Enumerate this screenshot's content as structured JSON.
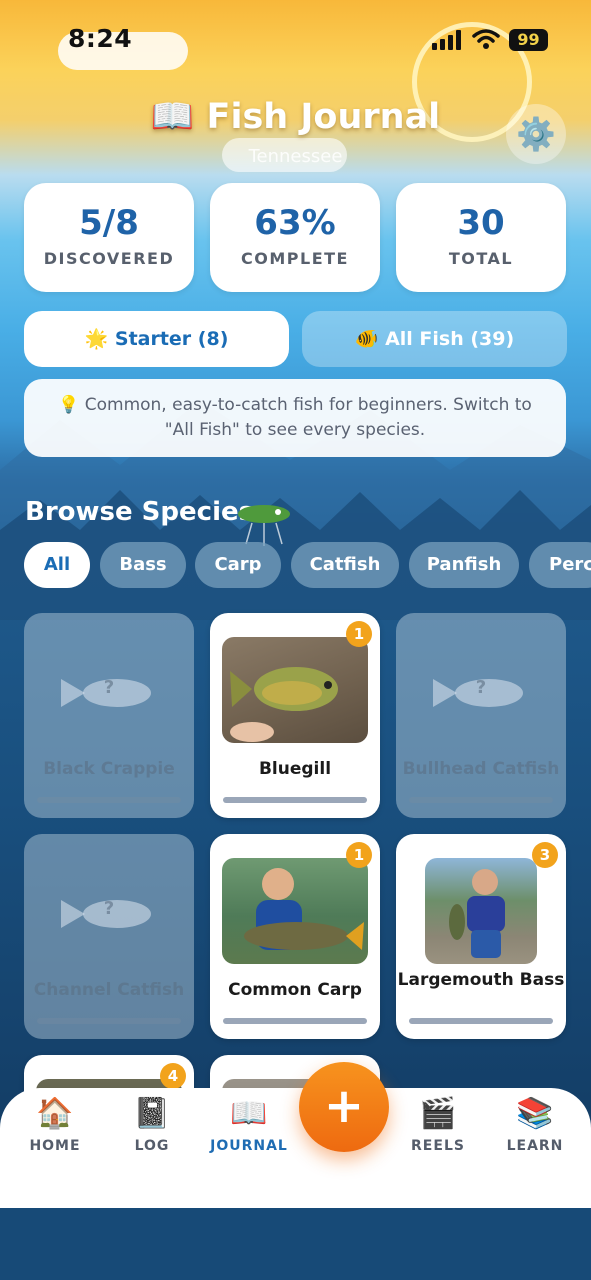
{
  "status_bar": {
    "time": "8:24",
    "battery": "99"
  },
  "header": {
    "title": "📖 Fish Journal",
    "subtitle": "Tennessee",
    "settings_icon": "⚙️"
  },
  "stats": [
    {
      "value": "5/8",
      "label": "DISCOVERED"
    },
    {
      "value": "63%",
      "label": "COMPLETE"
    },
    {
      "value": "30",
      "label": "TOTAL"
    }
  ],
  "mode_toggle": {
    "starter": "🌟 Starter (8)",
    "all_fish": "🐠 All Fish (39)",
    "selected": "starter"
  },
  "tip": {
    "icon": "💡",
    "text": "Common, easy-to-catch fish for beginners. Switch to \"All Fish\" to see every species."
  },
  "browse": {
    "title": "Browse Species",
    "filters": [
      "All",
      "Bass",
      "Carp",
      "Catfish",
      "Panfish",
      "Perc"
    ],
    "selected_filter": "All"
  },
  "species": [
    {
      "name": "Black Crappie",
      "discovered": false
    },
    {
      "name": "Bluegill",
      "discovered": true,
      "count": "1"
    },
    {
      "name": "Bullhead Catfish",
      "discovered": false
    },
    {
      "name": "Channel Catfish",
      "discovered": false
    },
    {
      "name": "Common Carp",
      "discovered": true,
      "count": "1"
    },
    {
      "name": "Largemouth Bass",
      "discovered": true,
      "count": "3"
    },
    {
      "name": "",
      "discovered": true,
      "count": "4"
    },
    {
      "name": "",
      "discovered": true,
      "count": ""
    }
  ],
  "unknown_mark": "?",
  "nav": {
    "items": [
      {
        "label": "HOME",
        "icon": "🏠"
      },
      {
        "label": "LOG",
        "icon": "📓"
      },
      {
        "label": "JOURNAL",
        "icon": "📖"
      },
      {
        "label": "REELS",
        "icon": "🎬"
      },
      {
        "label": "LEARN",
        "icon": "📚"
      }
    ],
    "active": "JOURNAL",
    "add_label": "+"
  },
  "colors": {
    "accent": "#1f63a8",
    "fab": "#f7931e",
    "badge": "#f2a31c"
  }
}
